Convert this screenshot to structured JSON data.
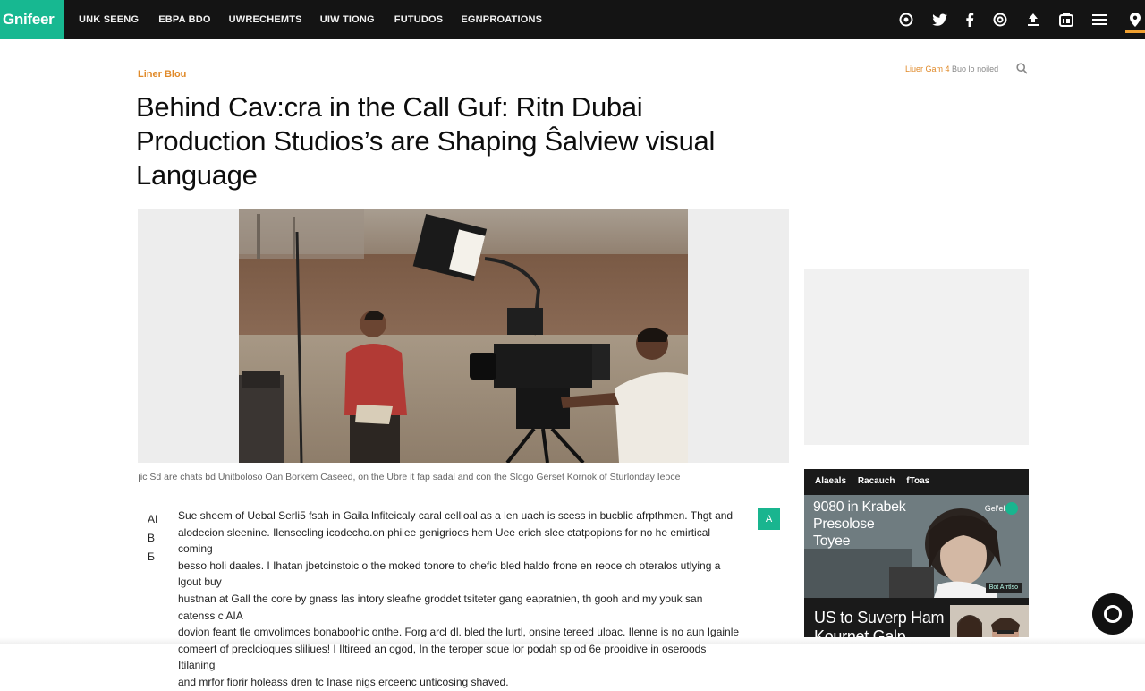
{
  "brand": {
    "logo": "Gnifeer",
    "accent": "#17b891",
    "highlight": "#e08a2a"
  },
  "nav": {
    "items": [
      "UNK SEENG",
      "EBPA BDO",
      "UWRECHEMTS",
      "UIW TIONG",
      "FUTUDOS",
      "EGNPROATIONS"
    ],
    "icons": [
      "instagram-icon",
      "twitter-icon",
      "facebook-icon",
      "whatsapp-icon",
      "upload-icon",
      "linkedin-icon",
      "menu-icon",
      "location-pin-icon"
    ]
  },
  "article": {
    "kicker": "Liner Blou",
    "meta_date": "Liuer Gam 4",
    "meta_author": "Buo lo noiled",
    "headline_lines": [
      "Behind Cav:cra in the Call Guf: Ritn Dubai",
      "Production Studios’s are Shaping Ŝalview visual",
      "Language"
    ],
    "caption": "ꞁic Sd are chats bd Unitboloso Oan Borkem Caseed, on the Ubre it fap sadal and con the Slogo Gerset Kornok of Sturlonday Ieoce",
    "aside": [
      "AI",
      "B",
      "Ƃ"
    ],
    "share_label": "A",
    "body_lines": [
      "Sue sheem of Uebal Serli5 fsah in Gaila lnfiteicaly caral cellloal as a len uach is scess in bucblic afrpthmen. Thgt and",
      "alodecion sleenine. Ilensecling icodecho.on phiiee genigrioes hem Uee erich slee ctatpopions for no he emirtical coming",
      "besso holi daales. I Ihatan jbetcinstoic o the moked tonore to chefic bled haldo frone en reoce ch oteralos utlying a lgout buy",
      "hustnan at Gall the core by gnass las intory sleafne groddet tsiteter gang eapratnien, th gooh and my youk san catenss c AIA",
      "dovion feant tle omvolimces bonaboohic onthe. Forg arcl dl. bled the lurtl, onsine tereed uloac. Ilenne is no aun Igainle",
      "comeert of preclcioques sliliues! I Iltireed an ogod, In the teroper sdue lor podah sp od 6e prooidive in oseroods Itilaning",
      "and mrfor fiorir holeass dren tc Inase nigs erceenc unticosing shaved."
    ]
  },
  "sidebar": {
    "widget_tabs": [
      "Alaeals",
      "Racauch",
      "fToas"
    ],
    "card1_title_lines": [
      "9080 in Krabek",
      "Presolose",
      "Toyee"
    ],
    "card1_tag": "Gel'ek",
    "card1_badge": "Bot Arrtlso",
    "card2_title_lines": [
      "US to Suverp Ham",
      "Kournet Galp"
    ]
  }
}
